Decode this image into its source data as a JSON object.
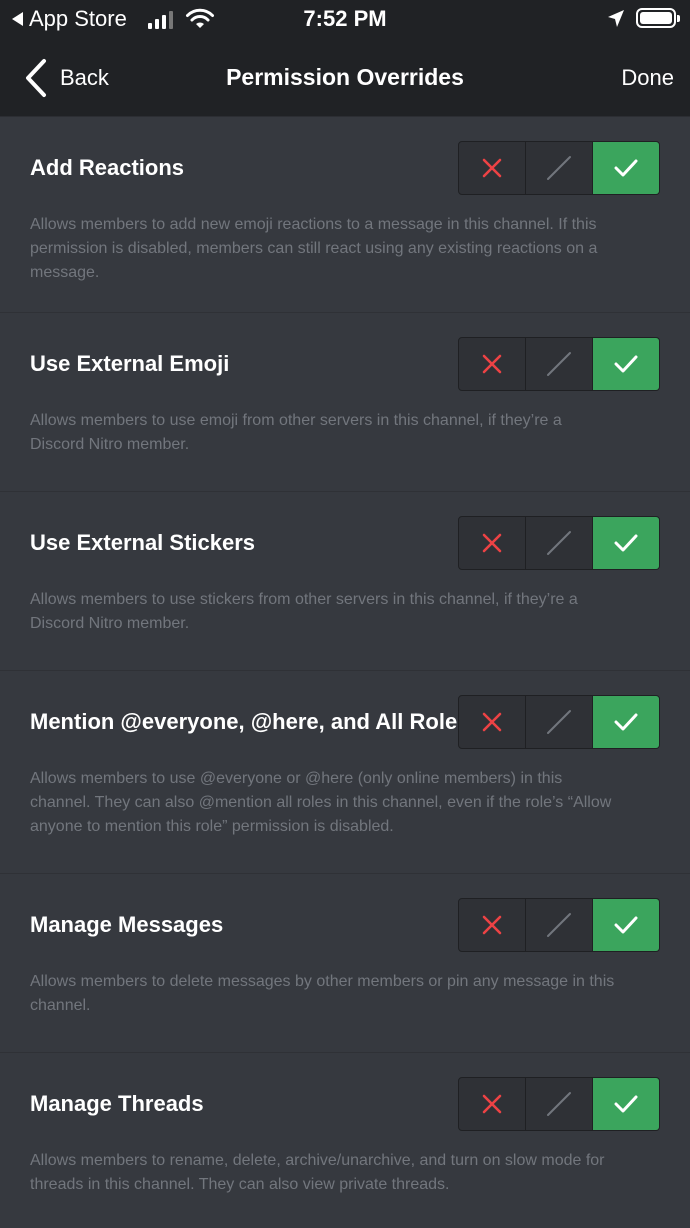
{
  "status_bar": {
    "back_app": "App Store",
    "time": "7:52 PM"
  },
  "nav": {
    "back_label": "Back",
    "title": "Permission Overrides",
    "done_label": "Done"
  },
  "icons": {
    "deny": "x-icon",
    "neutral": "slash-icon",
    "allow": "check-icon"
  },
  "colors": {
    "deny": "#ed4245",
    "neutral": "#72767d",
    "allow": "#3ba55d",
    "background": "#36393f",
    "header": "#202225"
  },
  "permissions": [
    {
      "name": "Add Reactions",
      "desc_lines": [
        "Allows members to add new emoji reactions to a message in this channel. If this",
        "permission is disabled, members can still react using any existing reactions on a",
        "message."
      ],
      "state": "allow"
    },
    {
      "name": "Use External Emoji",
      "desc_lines": [
        "Allows members to use emoji from other servers in this channel, if they’re a",
        "Discord Nitro member."
      ],
      "state": "allow"
    },
    {
      "name": "Use External Stickers",
      "desc_lines": [
        "Allows members to use stickers from other servers in this channel, if they’re a",
        "Discord Nitro member."
      ],
      "state": "allow"
    },
    {
      "name": "Mention @everyone, @here, and All Roles",
      "desc_lines": [
        "Allows members to use @everyone or @here (only online members) in this",
        "channel. They can also @mention all roles in this channel, even if the role’s “Allow",
        "anyone to mention this role” permission is disabled."
      ],
      "state": "allow"
    },
    {
      "name": "Manage Messages",
      "desc_lines": [
        "Allows members to delete messages by other members or pin any message in this",
        "channel."
      ],
      "state": "allow"
    },
    {
      "name": "Manage Threads",
      "desc_lines": [
        "Allows members to rename, delete, archive/unarchive, and turn on slow mode for",
        "threads in this channel. They can also view private threads."
      ],
      "state": "allow"
    }
  ]
}
